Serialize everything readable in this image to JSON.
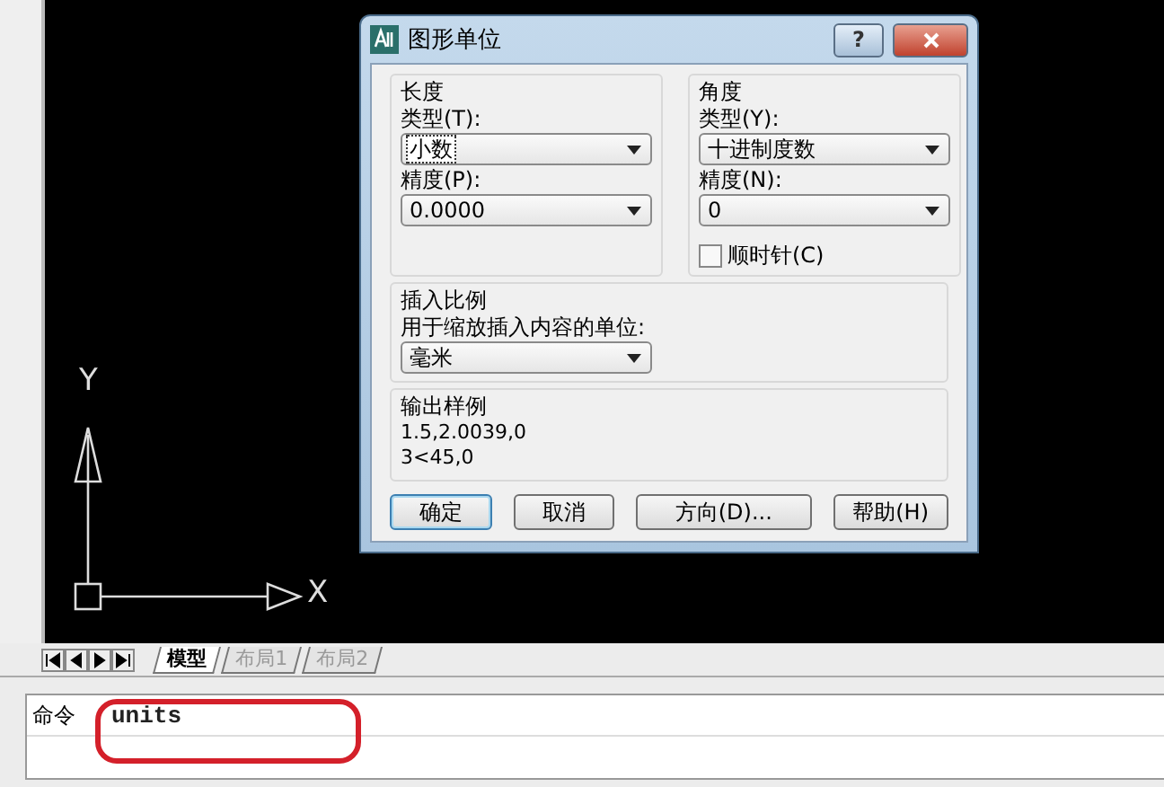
{
  "canvas": {
    "x_axis_label": "X",
    "y_axis_label": "Y"
  },
  "dialog": {
    "title": "图形单位",
    "help_button": "?",
    "length": {
      "heading": "长度",
      "type_label": "类型(T):",
      "type_value": "小数",
      "type_focused": true,
      "precision_label": "精度(P):",
      "precision_value": "0.0000"
    },
    "angle": {
      "heading": "角度",
      "type_label": "类型(Y):",
      "type_value": "十进制度数",
      "precision_label": "精度(N):",
      "precision_value": "0",
      "clockwise": {
        "label": "顺时针(C)",
        "checked": false
      }
    },
    "insert_scale": {
      "heading": "插入比例",
      "label": "用于缩放插入内容的单位:",
      "value": "毫米"
    },
    "sample_output": {
      "heading": "输出样例",
      "lines": [
        "1.5,2.0039,0",
        "3<45,0"
      ]
    },
    "buttons": [
      {
        "label": "确定",
        "default": true
      },
      {
        "label": "取消",
        "default": false
      },
      {
        "label": "方向(D)...",
        "default": false
      },
      {
        "label": "帮助(H)",
        "default": false
      }
    ]
  },
  "layout_tabs": [
    {
      "label": "模型",
      "selected": true
    },
    {
      "label": "布局1",
      "selected": false
    },
    {
      "label": "布局2",
      "selected": false
    }
  ],
  "command_line": {
    "prompt": "命令",
    "input": "units",
    "highlighted": true
  }
}
